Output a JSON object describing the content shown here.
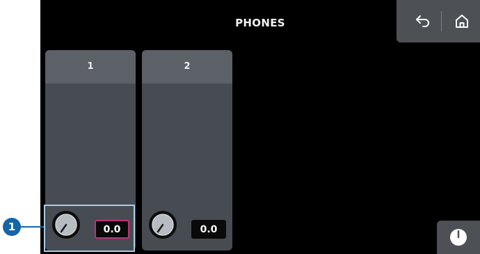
{
  "screen": {
    "title": "PHONES"
  },
  "nav": {
    "back_icon": "back-arrow-icon",
    "home_icon": "home-icon"
  },
  "channels": [
    {
      "label": "1",
      "value": "0.0",
      "selected": true
    },
    {
      "label": "2",
      "value": "0.0",
      "selected": false
    }
  ],
  "callout": {
    "number": "1"
  },
  "meter_button": {
    "icon": "meter-icon"
  },
  "colors": {
    "selected_border": "#c2317a",
    "highlight": "#a9cbe6",
    "callout": "#1665a7"
  }
}
